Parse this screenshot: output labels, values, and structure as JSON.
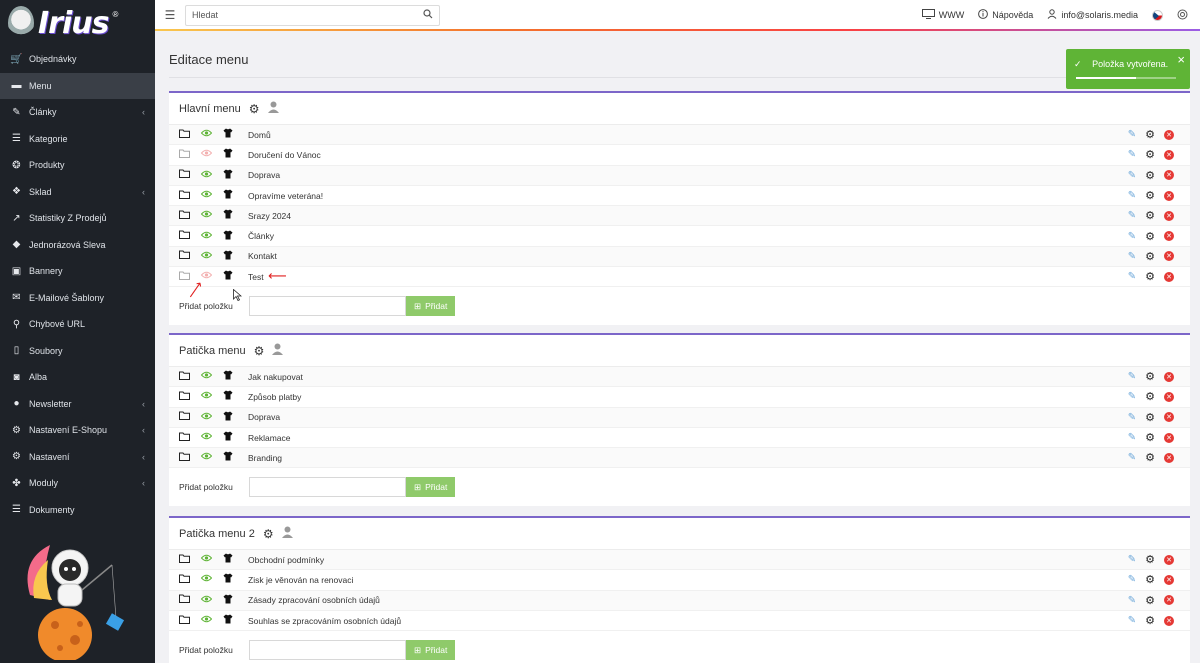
{
  "sidebar": {
    "logo_text": "Irius",
    "logo_reg": "®",
    "items": [
      {
        "label": "Objednávky",
        "icon": "cart-icon",
        "caret": false,
        "active": false
      },
      {
        "label": "Menu",
        "icon": "folder-icon",
        "caret": false,
        "active": true
      },
      {
        "label": "Články",
        "icon": "pencil-icon",
        "caret": true,
        "active": false
      },
      {
        "label": "Kategorie",
        "icon": "list-icon",
        "caret": false,
        "active": false
      },
      {
        "label": "Produkty",
        "icon": "aperture-icon",
        "caret": false,
        "active": false
      },
      {
        "label": "Sklad",
        "icon": "dropbox-icon",
        "caret": true,
        "active": false
      },
      {
        "label": "Statistiky Z Prodejů",
        "icon": "chart-icon",
        "caret": false,
        "active": false
      },
      {
        "label": "Jednorázová Sleva",
        "icon": "tag-icon",
        "caret": false,
        "active": false
      },
      {
        "label": "Bannery",
        "icon": "image-icon",
        "caret": false,
        "active": false
      },
      {
        "label": "E-Mailové Šablony",
        "icon": "envelope-icon",
        "caret": false,
        "active": false
      },
      {
        "label": "Chybové URL",
        "icon": "link-icon",
        "caret": false,
        "active": false
      },
      {
        "label": "Soubory",
        "icon": "file-icon",
        "caret": false,
        "active": false
      },
      {
        "label": "Alba",
        "icon": "camera-icon",
        "caret": false,
        "active": false
      },
      {
        "label": "Newsletter",
        "icon": "newsletter-icon",
        "caret": true,
        "active": false
      },
      {
        "label": "Nastavení E-Shopu",
        "icon": "cogs-icon",
        "caret": true,
        "active": false
      },
      {
        "label": "Nastavení",
        "icon": "cogs-icon",
        "caret": true,
        "active": false
      },
      {
        "label": "Moduly",
        "icon": "puzzle-icon",
        "caret": true,
        "active": false
      },
      {
        "label": "Dokumenty",
        "icon": "list-icon",
        "caret": false,
        "active": false
      }
    ]
  },
  "topbar": {
    "search_placeholder": "Hledat",
    "www_label": "WWW",
    "help_label": "Nápověda",
    "user_label": "info@solaris.media"
  },
  "page": {
    "title": "Editace menu"
  },
  "toast": {
    "message": "Položka vytvořena.",
    "progress": 0.6
  },
  "add_label": "Přidat položku",
  "add_button": "Přidat",
  "menus": [
    {
      "title": "Hlavní menu",
      "items": [
        {
          "label": "Domů",
          "visible": true
        },
        {
          "label": "Doručení do Vánoc",
          "visible": false
        },
        {
          "label": "Doprava",
          "visible": true
        },
        {
          "label": "Opravíme veteránа!",
          "visible": true
        },
        {
          "label": "Srazy 2024",
          "visible": true
        },
        {
          "label": "Články",
          "visible": true
        },
        {
          "label": "Kontakt",
          "visible": true
        },
        {
          "label": "Test",
          "visible": false
        }
      ]
    },
    {
      "title": "Patička menu",
      "items": [
        {
          "label": "Jak nakupovat",
          "visible": true
        },
        {
          "label": "Způsob platby",
          "visible": true
        },
        {
          "label": "Doprava",
          "visible": true
        },
        {
          "label": "Reklamace",
          "visible": true
        },
        {
          "label": "Branding",
          "visible": true
        }
      ]
    },
    {
      "title": "Patička menu 2",
      "items": [
        {
          "label": "Obchodní podmínky",
          "visible": true
        },
        {
          "label": "Zisk je věnován na renovaci",
          "visible": true
        },
        {
          "label": "Zásady zpracování osobních údajů",
          "visible": true
        },
        {
          "label": "Souhlas se zpracováním osobních údajů",
          "visible": true
        }
      ]
    }
  ],
  "colors": {
    "sidebar_bg": "#1e2228",
    "accent_purple": "#7c66c9",
    "success_green": "#5fb436",
    "add_button_green": "#8fca6a",
    "delete_red": "#e53935"
  }
}
